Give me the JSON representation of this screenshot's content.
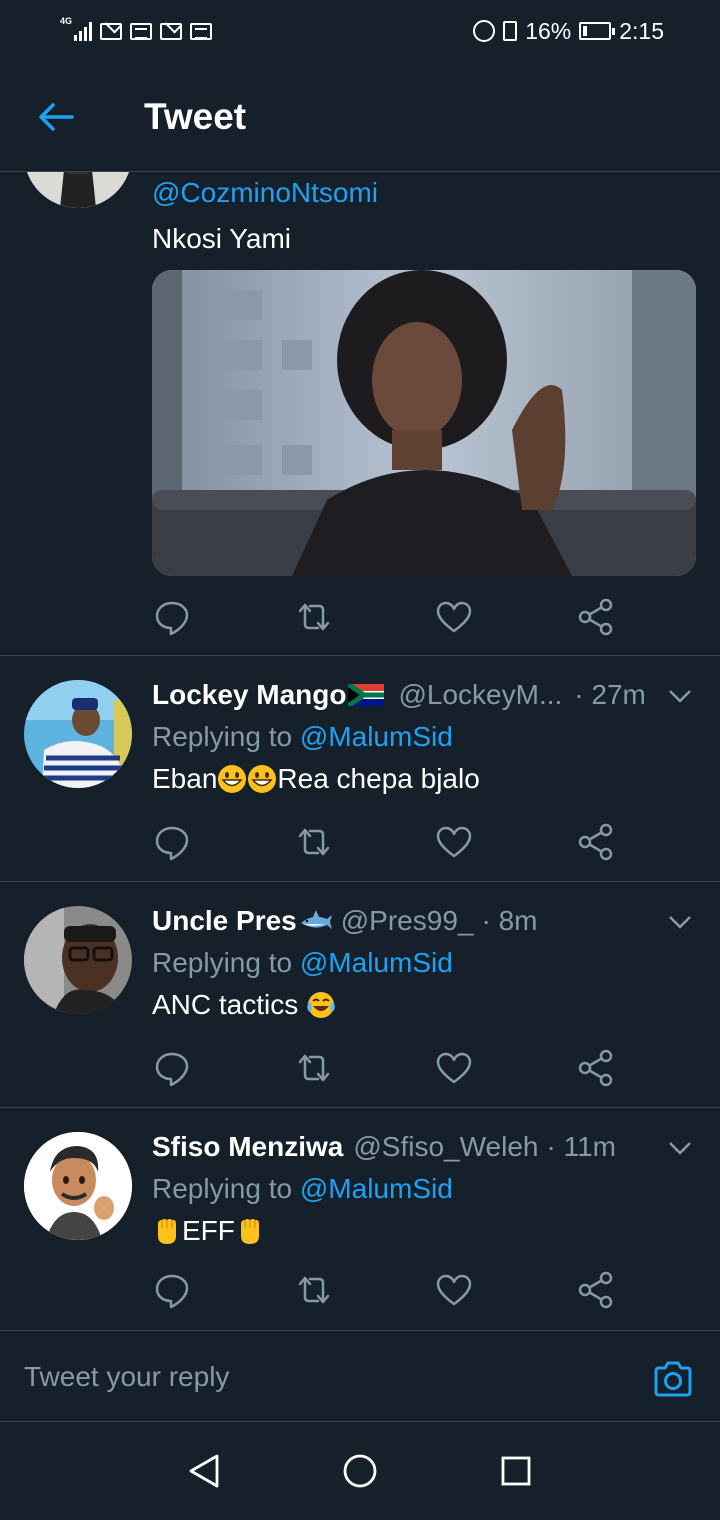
{
  "status_bar": {
    "network": "4G",
    "battery_percent": "16%",
    "battery_level": 0.16,
    "time": "2:15"
  },
  "header": {
    "title": "Tweet",
    "back_icon": "arrow-left-icon"
  },
  "colors": {
    "background": "#15202b",
    "accent": "#1da1f2",
    "secondary_text": "#8899a6",
    "divider": "#38444d"
  },
  "main_tweet": {
    "handle": "@CozminoNtsomi",
    "text": "Nkosi Yami",
    "media_icon": "photo-media"
  },
  "replies": [
    {
      "name": "Lockey Mango",
      "badge_icon": "south-africa-flag-icon",
      "handle": "@LockeyM...",
      "time": "· 27m",
      "replying_prefix": "Replying to ",
      "replying_to": "@MalumSid",
      "text_parts": [
        "Eban",
        "Rea chepa bjalo"
      ],
      "emoji": "grinning-face-icon"
    },
    {
      "name": "Uncle Pres",
      "badge_icon": "shark-icon",
      "handle": "@Pres99_",
      "time": "· 8m",
      "replying_prefix": "Replying to ",
      "replying_to": "@MalumSid",
      "text": "ANC tactics",
      "emoji": "tears-of-joy-icon"
    },
    {
      "name": "Sfiso Menziwa",
      "handle": "@Sfiso_Weleh",
      "time": "· 11m",
      "replying_prefix": "Replying to ",
      "replying_to": "@MalumSid",
      "text": "EFF",
      "emoji": "raised-fist-icon"
    }
  ],
  "action_icons": [
    "reply-icon",
    "retweet-icon",
    "like-icon",
    "share-icon"
  ],
  "reply_bar": {
    "placeholder": "Tweet your reply",
    "camera_icon": "camera-icon"
  },
  "nav_bar": {
    "buttons": [
      "back-triangle-icon",
      "home-circle-icon",
      "recents-square-icon"
    ]
  }
}
